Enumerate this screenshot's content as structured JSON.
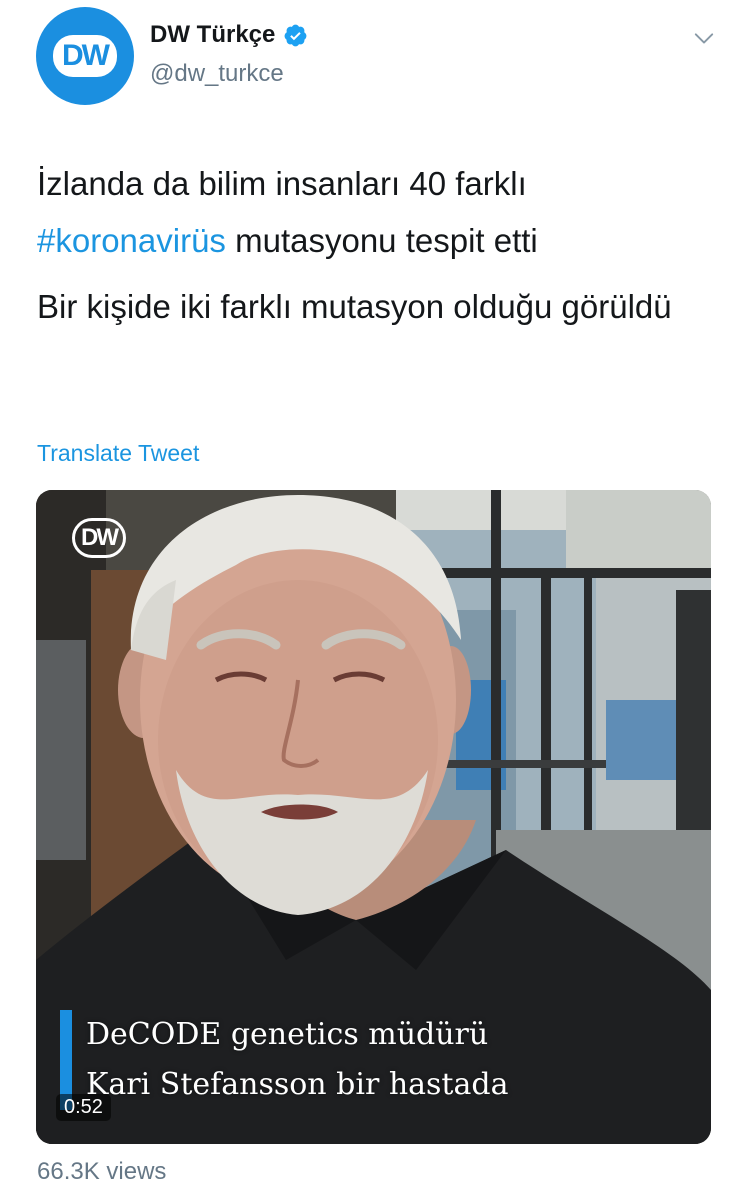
{
  "author": {
    "avatar_logo_text": "DW",
    "display_name": "DW Türkçe",
    "handle": "@dw_turkce",
    "verified": true
  },
  "tweet": {
    "line1_text": "İzlanda da bilim insanları 40 farklı",
    "hashtag": "#koronavirüs",
    "line2_rest": " mutasyonu tespit etti",
    "paragraph2": "Bir kişide iki farklı mutasyon olduğu görüldü",
    "translate_label": "Translate Tweet"
  },
  "video": {
    "watermark_logo_text": "DW",
    "caption_line1": "DeCODE genetics müdürü",
    "caption_line2": "Kari Stefansson bir hastada",
    "duration": "0:52"
  },
  "stats": {
    "views": "66.3K views"
  },
  "colors": {
    "brand_blue": "#1b8fe0",
    "link_blue": "#1b95e0",
    "secondary_text": "#657786"
  },
  "icons": {
    "verified": "verified-badge-icon",
    "caret": "chevron-down-icon"
  }
}
